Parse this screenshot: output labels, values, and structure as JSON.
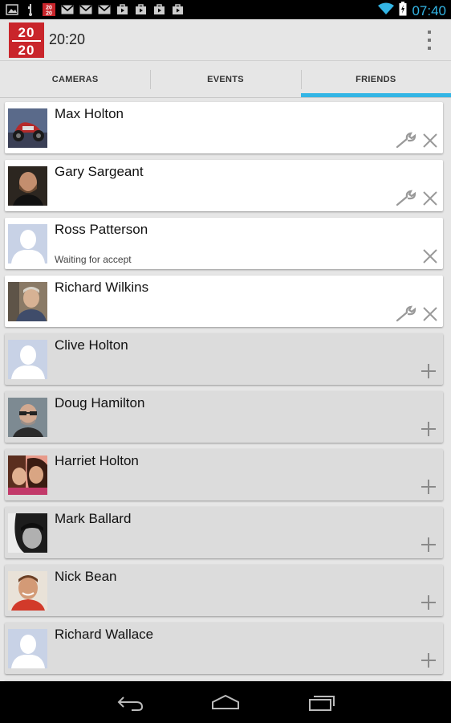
{
  "status_bar": {
    "clock": "07:40",
    "accent": "#33b5e5",
    "notification_icons": [
      "image-icon",
      "usb-icon",
      "app-2020-icon",
      "gmail-icon",
      "gmail-icon",
      "gmail-icon",
      "play-store-icon",
      "play-store-icon",
      "play-store-icon",
      "play-store-icon"
    ],
    "system_icons": [
      "wifi-icon",
      "battery-charging-icon"
    ]
  },
  "action_bar": {
    "logo_top": "20",
    "logo_bottom": "20",
    "title": "20:20",
    "menu_icon": "overflow-menu-icon"
  },
  "tabs": [
    {
      "label": "CAMERAS",
      "active": false
    },
    {
      "label": "EVENTS",
      "active": false
    },
    {
      "label": "FRIENDS",
      "active": true
    }
  ],
  "friends": [
    {
      "name": "Max Holton",
      "status": "",
      "avatar": "motorbike-photo",
      "actions": [
        "wrench-icon",
        "close-icon"
      ]
    },
    {
      "name": "Gary Sargeant",
      "status": "",
      "avatar": "man-photo",
      "actions": [
        "wrench-icon",
        "close-icon"
      ]
    },
    {
      "name": "Ross Patterson",
      "status": "Waiting for accept",
      "avatar": "default-silhouette",
      "actions": [
        "close-icon"
      ]
    },
    {
      "name": "Richard Wilkins",
      "status": "",
      "avatar": "man-photo",
      "actions": [
        "wrench-icon",
        "close-icon"
      ]
    }
  ],
  "suggestions": [
    {
      "name": "Clive Holton",
      "avatar": "default-silhouette",
      "actions": [
        "plus-icon"
      ]
    },
    {
      "name": "Doug Hamilton",
      "avatar": "man-glasses-photo",
      "actions": [
        "plus-icon"
      ]
    },
    {
      "name": "Harriet Holton",
      "avatar": "two-women-photo",
      "actions": [
        "plus-icon"
      ]
    },
    {
      "name": "Mark Ballard",
      "avatar": "bw-portrait-photo",
      "actions": [
        "plus-icon"
      ]
    },
    {
      "name": "Nick Bean",
      "avatar": "smiling-man-photo",
      "actions": [
        "plus-icon"
      ]
    },
    {
      "name": "Richard Wallace",
      "avatar": "default-silhouette",
      "actions": [
        "plus-icon"
      ]
    }
  ],
  "nav_bar": {
    "buttons": [
      "back-icon",
      "home-icon",
      "recents-icon"
    ]
  }
}
